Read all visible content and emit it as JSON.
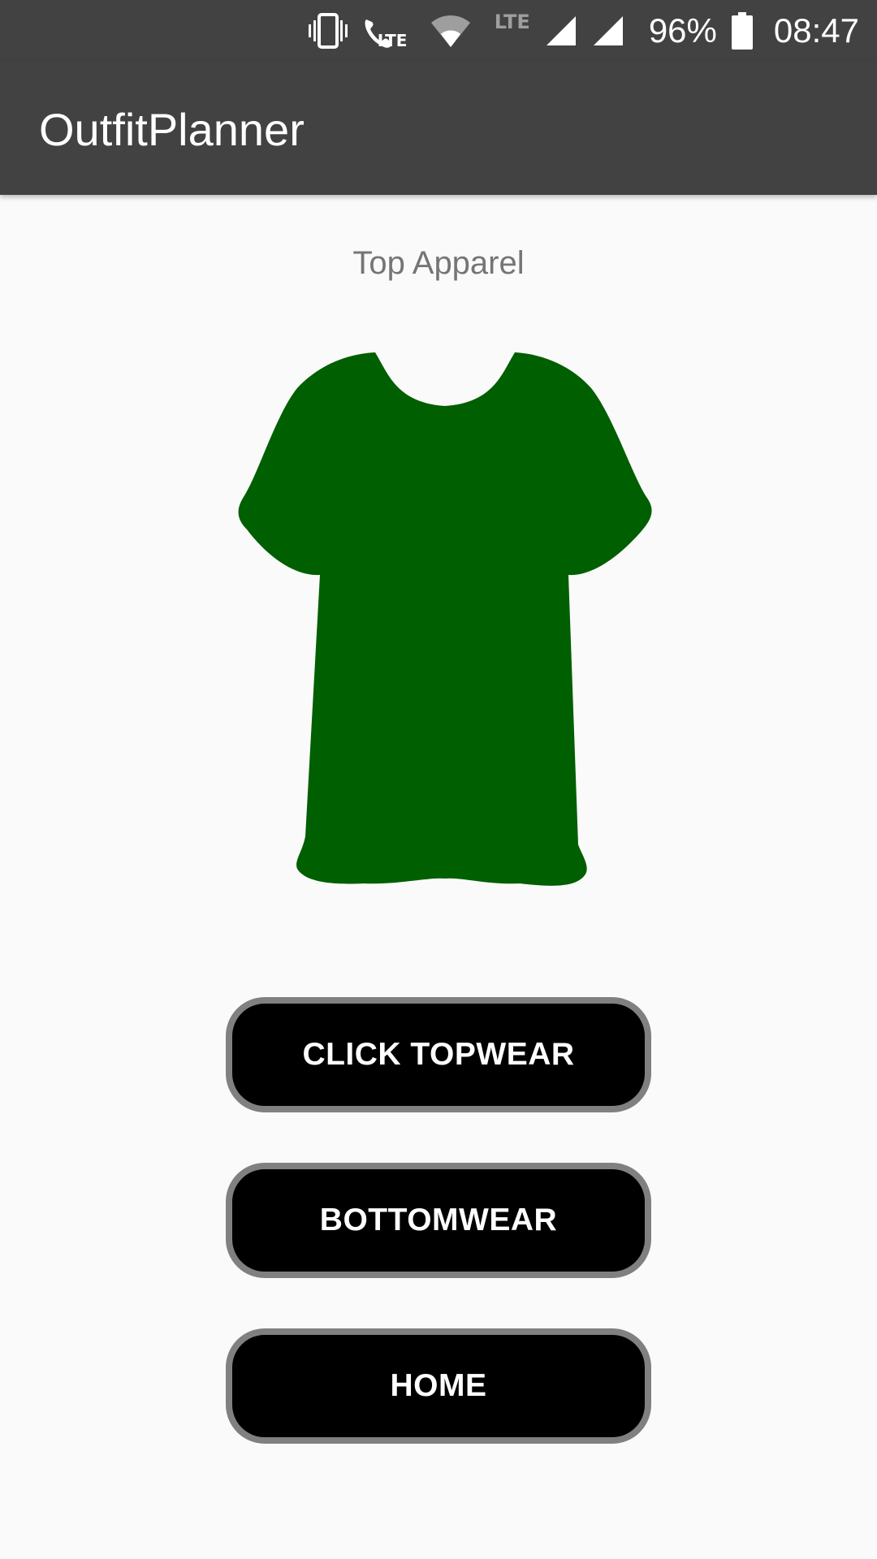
{
  "status_bar": {
    "lte_small": "LTE",
    "lte_label": "LTE",
    "battery": "96%",
    "time": "08:47",
    "icons": [
      "vibrate-icon",
      "volte-call-icon",
      "wifi-icon",
      "signal-icon",
      "signal-icon",
      "battery-icon"
    ]
  },
  "app_bar": {
    "title": "OutfitPlanner"
  },
  "main": {
    "section_label": "Top Apparel",
    "garment_color": "#005f00",
    "buttons": {
      "topwear": "CLICK TOPWEAR",
      "bottomwear": "BOTTOMWEAR",
      "home": "HOME"
    }
  },
  "colors": {
    "bar": "#424242",
    "background": "#fafafa",
    "button_fill": "#000000",
    "button_border": "#808080"
  }
}
